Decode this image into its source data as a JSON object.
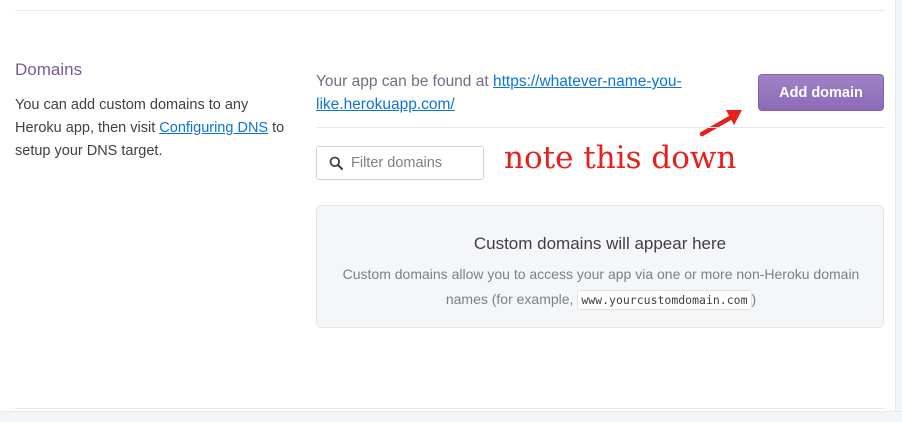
{
  "section": {
    "title": "Domains",
    "description_part1": "You can add custom domains to any Heroku app, then visit ",
    "configuring_dns_link": "Configuring DNS",
    "description_part2": " to setup your DNS target."
  },
  "app_url": {
    "prefix": "Your app can be found at ",
    "link": "https://whatever-name-you-like.herokuapp.com/"
  },
  "add_domain_button": "Add domain",
  "filter": {
    "placeholder": "Filter domains",
    "value": ""
  },
  "annotation": "note this down",
  "empty_state": {
    "title": "Custom domains will appear here",
    "desc_part1": "Custom domains allow you to access your app via one or more non-Heroku domain names (for example, ",
    "example_code": "www.yourcustomdomain.com",
    "desc_part2": ")"
  },
  "colors": {
    "accent_purple": "#79589f",
    "button_purple": "#8b6bb8",
    "link_blue": "#0c74d8",
    "annotation_red": "#e8201c"
  },
  "icons": [
    "search-icon",
    "arrow-annotation-icon"
  ]
}
